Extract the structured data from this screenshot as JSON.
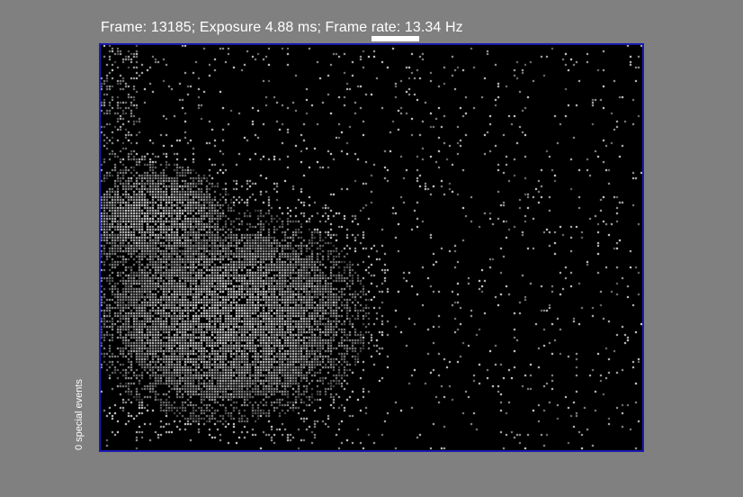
{
  "status": {
    "text": "Frame: 13185; Exposure 4.88 ms; Frame rate: 13.34 Hz",
    "frame": 13185,
    "exposure_ms": 4.88,
    "frame_rate_hz": 13.34
  },
  "side_label": {
    "text": "0 special events"
  },
  "view": {
    "border_color": "#1a1ab0",
    "background_color": "#000000",
    "page_background": "#808080"
  }
}
